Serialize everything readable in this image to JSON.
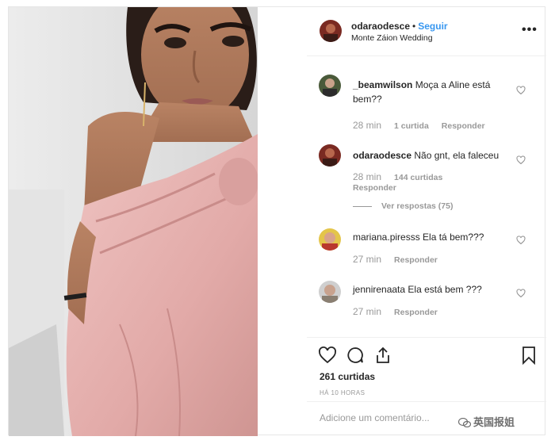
{
  "post": {
    "username": "odaraodesce",
    "follow_label": "Seguir",
    "location": "Monte Záion Wedding",
    "more_icon": "more-options-icon"
  },
  "comments": [
    {
      "user": "_beamwilson",
      "text": "Moça a Aline está bem??",
      "time": "28 min",
      "likes": "1 curtida",
      "reply": "Responder"
    },
    {
      "user": "odaraodesce",
      "text": "Não gnt, ela faleceu",
      "time": "28 min",
      "likes": "144 curtidas",
      "reply": "Responder",
      "view_replies": "Ver respostas (75)"
    },
    {
      "user": "mariana.piresss",
      "text": "Ela tá bem???",
      "time": "27 min",
      "reply": "Responder"
    },
    {
      "user": "jennirenaata",
      "text": "Ela está bem ???",
      "time": "27 min",
      "reply": "Responder"
    }
  ],
  "actions": {
    "likes_count": "261 curtidas",
    "posted_ago": "HÁ 10 HORAS",
    "icons": [
      "heart-icon",
      "comment-icon",
      "share-icon",
      "bookmark-icon"
    ]
  },
  "add_comment": {
    "placeholder": "Adicione um comentário..."
  },
  "watermark": {
    "text": "英国报姐"
  },
  "colors": {
    "link": "#3897f0",
    "text": "#262626",
    "muted": "#999999",
    "dress": "#e8b4b4"
  }
}
